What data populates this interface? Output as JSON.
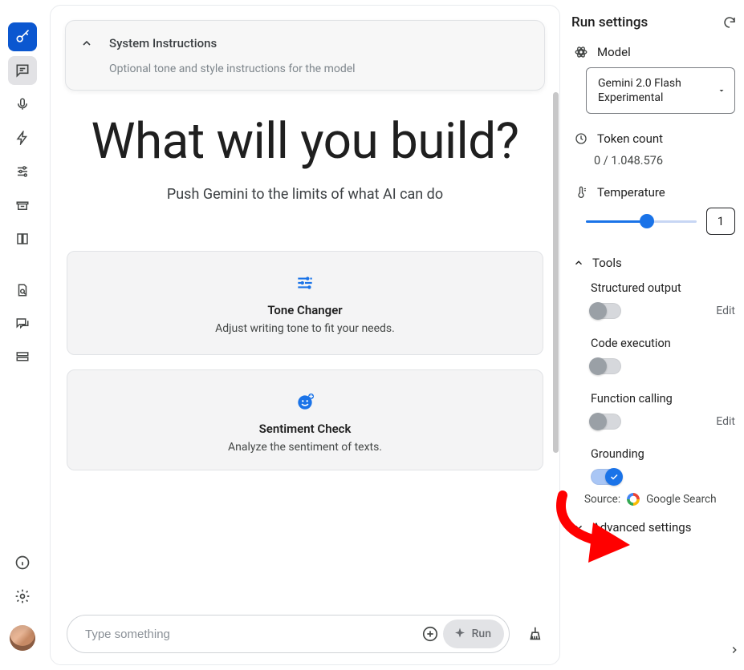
{
  "system_instructions": {
    "title": "System Instructions",
    "subtitle": "Optional tone and style instructions for the model"
  },
  "hero": {
    "title": "What will you build?",
    "subtitle": "Push Gemini to the limits of what AI can do"
  },
  "suggestions": [
    {
      "title": "Tone Changer",
      "desc": "Adjust writing tone to fit your needs."
    },
    {
      "title": "Sentiment Check",
      "desc": "Analyze the sentiment of texts."
    }
  ],
  "prompt": {
    "placeholder": "Type something",
    "run_label": "Run"
  },
  "settings": {
    "header": "Run settings",
    "model_label": "Model",
    "model_value": "Gemini 2.0 Flash Experimental",
    "token_label": "Token count",
    "token_value": "0 / 1.048.576",
    "temperature_label": "Temperature",
    "temperature_value": "1",
    "tools_label": "Tools",
    "tools": {
      "structured_output": {
        "name": "Structured output",
        "edit": "Edit"
      },
      "code_execution": {
        "name": "Code execution"
      },
      "function_calling": {
        "name": "Function calling",
        "edit": "Edit"
      },
      "grounding": {
        "name": "Grounding",
        "source_label": "Source:",
        "source_name": "Google Search"
      }
    },
    "advanced_label": "Advanced settings"
  }
}
